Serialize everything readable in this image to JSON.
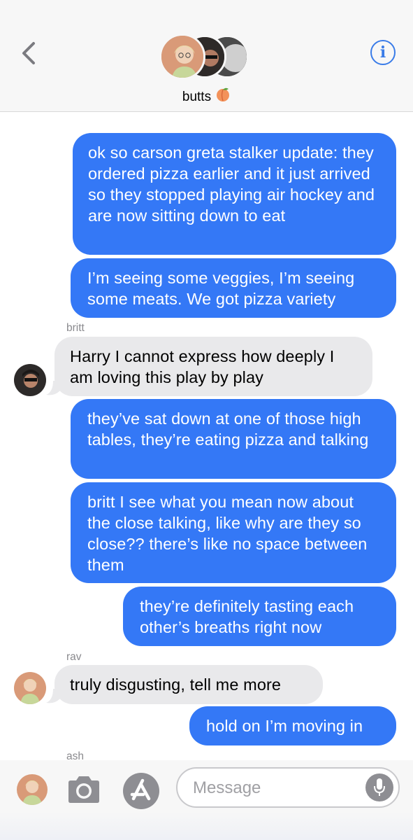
{
  "header": {
    "group_name": "butts",
    "group_emoji": "peach-emoji",
    "back_icon": "chevron-left-icon",
    "info_icon": "info-icon",
    "info_glyph": "i"
  },
  "messages": [
    {
      "direction": "out",
      "text": "ok so carson greta stalker update: they ordered pizza earlier and it just arrived so they stopped playing air hockey and are now sitting down to eat"
    },
    {
      "direction": "out",
      "text": "I’m seeing some veggies, I’m seeing some meats. We got pizza variety"
    },
    {
      "direction": "in",
      "sender": "britt",
      "text": "Harry I cannot express how deeply I am loving this play by play"
    },
    {
      "direction": "out",
      "text": "they’ve sat down at one of those high tables, they’re eating pizza and talking"
    },
    {
      "direction": "out",
      "text": "britt I see what you mean now about the close talking, like why are they so close?? there’s like no space between them"
    },
    {
      "direction": "out",
      "text": "they’re definitely tasting each other’s breaths right now"
    },
    {
      "direction": "in",
      "sender": "rav",
      "text": "truly disgusting, tell me more"
    },
    {
      "direction": "out",
      "text": "hold on I’m moving in"
    }
  ],
  "partial_sender": "ash",
  "composer": {
    "placeholder": "Message",
    "camera_icon": "camera-icon",
    "appstore_icon": "app-store-icon",
    "mic_icon": "microphone-icon"
  },
  "colors": {
    "outgoing_bubble": "#3478f6",
    "incoming_bubble": "#e9e9eb",
    "accent": "#3a7ce8"
  }
}
